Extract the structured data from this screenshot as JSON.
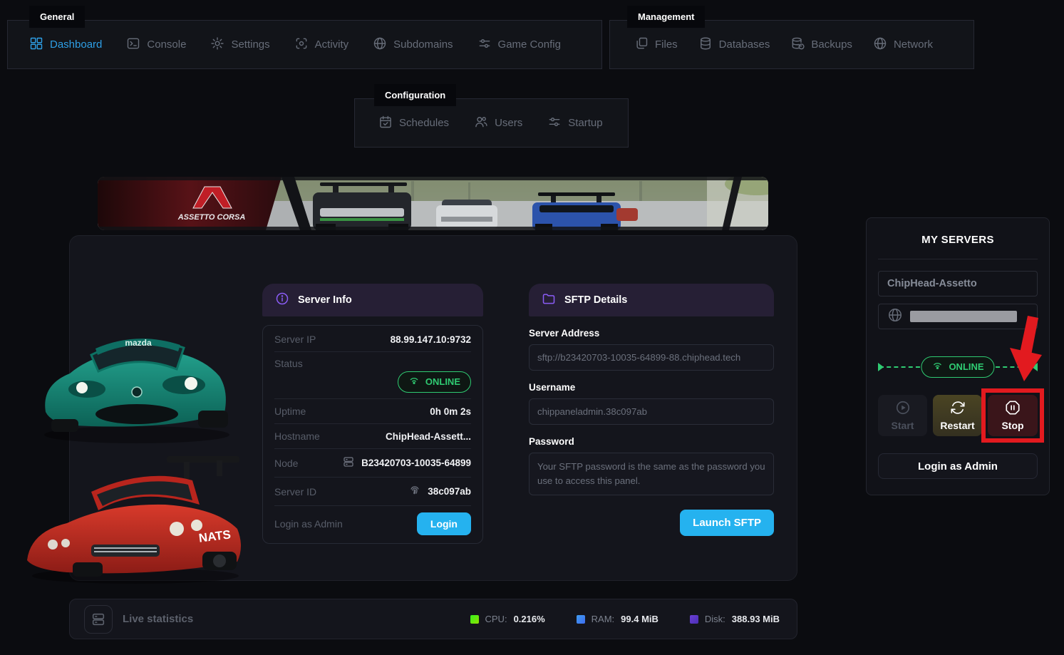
{
  "nav_general": {
    "label": "General",
    "items": [
      {
        "label": "Dashboard",
        "icon": "dashboard-icon",
        "active": true
      },
      {
        "label": "Console",
        "icon": "console-icon",
        "active": false
      },
      {
        "label": "Settings",
        "icon": "gear-icon",
        "active": false
      },
      {
        "label": "Activity",
        "icon": "activity-icon",
        "active": false
      },
      {
        "label": "Subdomains",
        "icon": "globe-icon",
        "active": false
      },
      {
        "label": "Game Config",
        "icon": "sliders-icon",
        "active": false
      }
    ]
  },
  "nav_management": {
    "label": "Management",
    "items": [
      {
        "label": "Files",
        "icon": "files-icon"
      },
      {
        "label": "Databases",
        "icon": "database-icon"
      },
      {
        "label": "Backups",
        "icon": "backup-icon"
      },
      {
        "label": "Network",
        "icon": "globe-icon"
      }
    ]
  },
  "nav_configuration": {
    "label": "Configuration",
    "items": [
      {
        "label": "Schedules",
        "icon": "calendar-check-icon"
      },
      {
        "label": "Users",
        "icon": "users-icon"
      },
      {
        "label": "Startup",
        "icon": "sliders-icon"
      }
    ]
  },
  "banner": {
    "logo": "ASSETTO CORSA"
  },
  "cars": {
    "teal_windshield_banner": "mazda",
    "red_livery": "NATS"
  },
  "server_info": {
    "title": "Server Info",
    "server_ip_label": "Server IP",
    "server_ip": "88.99.147.10:9732",
    "status_label": "Status",
    "status": "ONLINE",
    "uptime_label": "Uptime",
    "uptime": "0h 0m 2s",
    "hostname_label": "Hostname",
    "hostname": "ChipHead-Assett...",
    "node_label": "Node",
    "node": "B23420703-10035-64899",
    "server_id_label": "Server ID",
    "server_id": "38c097ab",
    "admin_label": "Login as Admin",
    "login_button": "Login"
  },
  "sftp": {
    "title": "SFTP Details",
    "address_label": "Server Address",
    "address": "sftp://b23420703-10035-64899-88.chiphead.tech",
    "username_label": "Username",
    "username": "chippaneladmin.38c097ab",
    "password_label": "Password",
    "password_note": "Your SFTP password is the same as the password you use to access this panel.",
    "launch_button": "Launch SFTP"
  },
  "my_servers": {
    "title": "MY SERVERS",
    "server_name": "ChipHead-Assetto",
    "status": "ONLINE",
    "start_button": "Start",
    "restart_button": "Restart",
    "stop_button": "Stop",
    "admin_button": "Login as Admin"
  },
  "live_stats": {
    "title": "Live statistics",
    "cpu_label": "CPU:",
    "cpu": "0.216%",
    "ram_label": "RAM:",
    "ram": "99.4 MiB",
    "disk_label": "Disk:",
    "disk": "388.93 MiB"
  },
  "colors": {
    "accent_blue": "#2e9fe6",
    "status_green": "#2fcb72",
    "button_cyan": "#25b2ef",
    "header_purple": "#8a5cf5",
    "annotation_red": "#e21a1f",
    "cpu_square": "#35f11c",
    "ram_square": "#3f9df0",
    "disk_square": "#6b3fd4"
  }
}
